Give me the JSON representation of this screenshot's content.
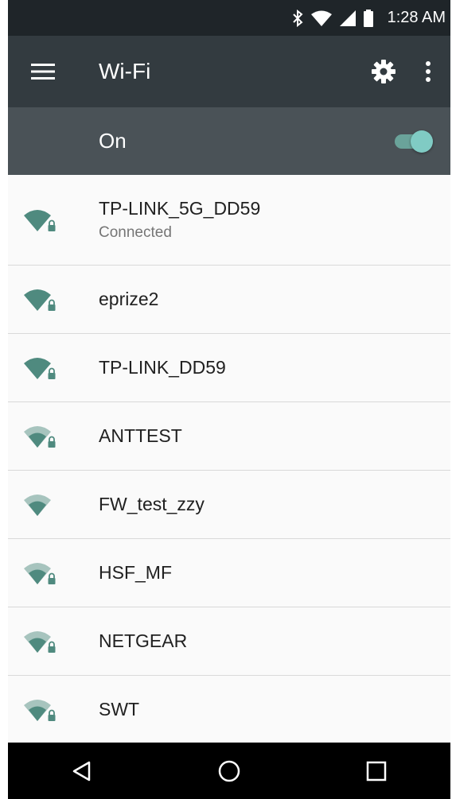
{
  "status_bar": {
    "time": "1:28 AM",
    "icons": [
      "bluetooth-icon",
      "wifi-signal-icon",
      "cell-signal-icon",
      "battery-icon"
    ]
  },
  "app_bar": {
    "title": "Wi-Fi",
    "menu_icon": "menu-icon",
    "settings_icon": "gear-icon",
    "overflow_icon": "more-vertical-icon"
  },
  "wifi_toggle": {
    "label": "On",
    "state": "on"
  },
  "networks": [
    {
      "ssid": "TP-LINK_5G_DD59",
      "status": "Connected",
      "signal": "full",
      "locked": true
    },
    {
      "ssid": "eprize2",
      "status": "",
      "signal": "full",
      "locked": true
    },
    {
      "ssid": "TP-LINK_DD59",
      "status": "",
      "signal": "full",
      "locked": true
    },
    {
      "ssid": "ANTTEST",
      "status": "",
      "signal": "medium",
      "locked": true
    },
    {
      "ssid": "FW_test_zzy",
      "status": "",
      "signal": "medium",
      "locked": false
    },
    {
      "ssid": "HSF_MF",
      "status": "",
      "signal": "medium",
      "locked": true
    },
    {
      "ssid": "NETGEAR",
      "status": "",
      "signal": "medium",
      "locked": true
    },
    {
      "ssid": "SWT",
      "status": "",
      "signal": "medium",
      "locked": true
    }
  ],
  "nav_bar": {
    "buttons": [
      "back-icon",
      "home-icon",
      "recents-icon"
    ]
  },
  "colors": {
    "status_bar": "#1f2529",
    "app_bar": "#333b40",
    "toggle_bar": "#4a5257",
    "accent": "#80cbc4",
    "wifi_icon": "#4f8a7f",
    "wifi_icon_faded": "#a7c4be"
  }
}
